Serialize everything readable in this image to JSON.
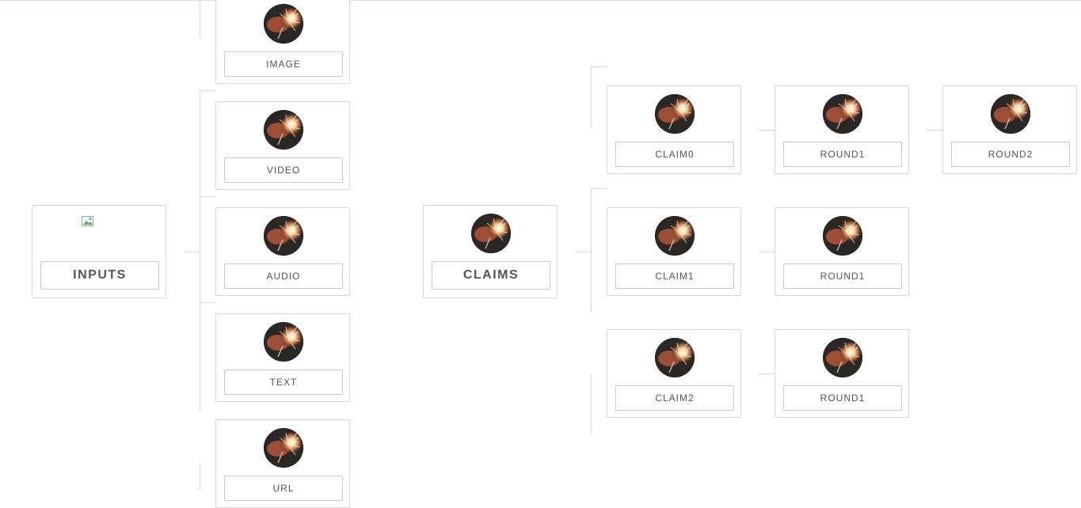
{
  "inputs": {
    "root_label": "INPUTS",
    "children": [
      {
        "id": "image",
        "label": "IMAGE"
      },
      {
        "id": "video",
        "label": "VIDEO"
      },
      {
        "id": "audio",
        "label": "AUDIO"
      },
      {
        "id": "text",
        "label": "TEXT"
      },
      {
        "id": "url",
        "label": "URL"
      }
    ]
  },
  "claims": {
    "root_label": "CLAIMS",
    "rows": [
      {
        "claim": "CLAIM0",
        "rounds": [
          "ROUND1",
          "ROUND2"
        ]
      },
      {
        "claim": "CLAIM1",
        "rounds": [
          "ROUND1"
        ]
      },
      {
        "claim": "CLAIM2",
        "rounds": [
          "ROUND1"
        ]
      }
    ]
  },
  "icons": {
    "node_avatar": "sparkler-photo-icon",
    "broken_image": "broken-image-icon"
  },
  "colors": {
    "border": "#d6d6d6",
    "connector": "#d9d9d9",
    "text": "#555555",
    "top_rule": "#f1dcd2"
  }
}
